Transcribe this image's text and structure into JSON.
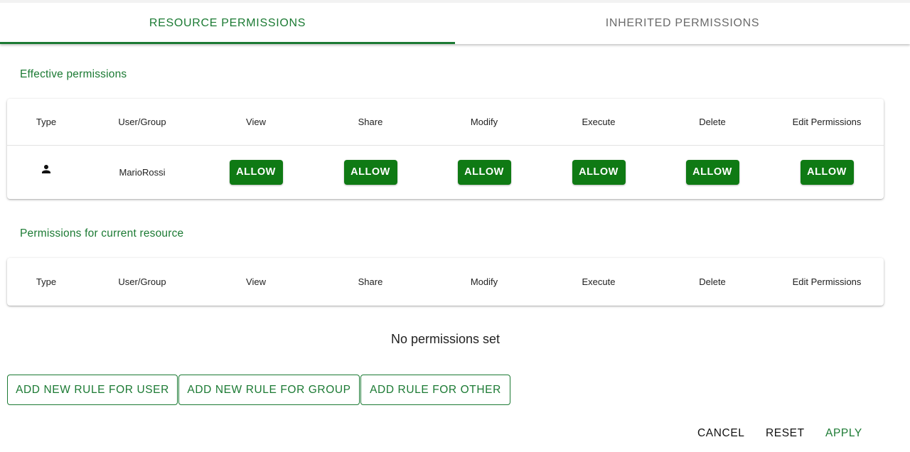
{
  "tabs": {
    "resource_label": "RESOURCE PERMISSIONS",
    "inherited_label": "INHERITED PERMISSIONS"
  },
  "columns": [
    "Type",
    "User/Group",
    "View",
    "Share",
    "Modify",
    "Execute",
    "Delete",
    "Edit Permissions"
  ],
  "effective": {
    "title": "Effective permissions",
    "rows": [
      {
        "type_icon": "person-icon",
        "user": "MarioRossi",
        "view": "ALLOW",
        "share": "ALLOW",
        "modify": "ALLOW",
        "execute": "ALLOW",
        "delete": "ALLOW",
        "edit_permissions": "ALLOW"
      }
    ]
  },
  "current": {
    "title": "Permissions for current resource",
    "empty_message": "No permissions set"
  },
  "actions": {
    "add_user": "ADD NEW RULE FOR USER",
    "add_group": "ADD NEW RULE FOR GROUP",
    "add_other": "ADD RULE FOR OTHER"
  },
  "footer": {
    "cancel": "CANCEL",
    "reset": "RESET",
    "apply": "APPLY"
  },
  "colors": {
    "accent": "#1b7a33",
    "allow": "#0f7a14"
  }
}
